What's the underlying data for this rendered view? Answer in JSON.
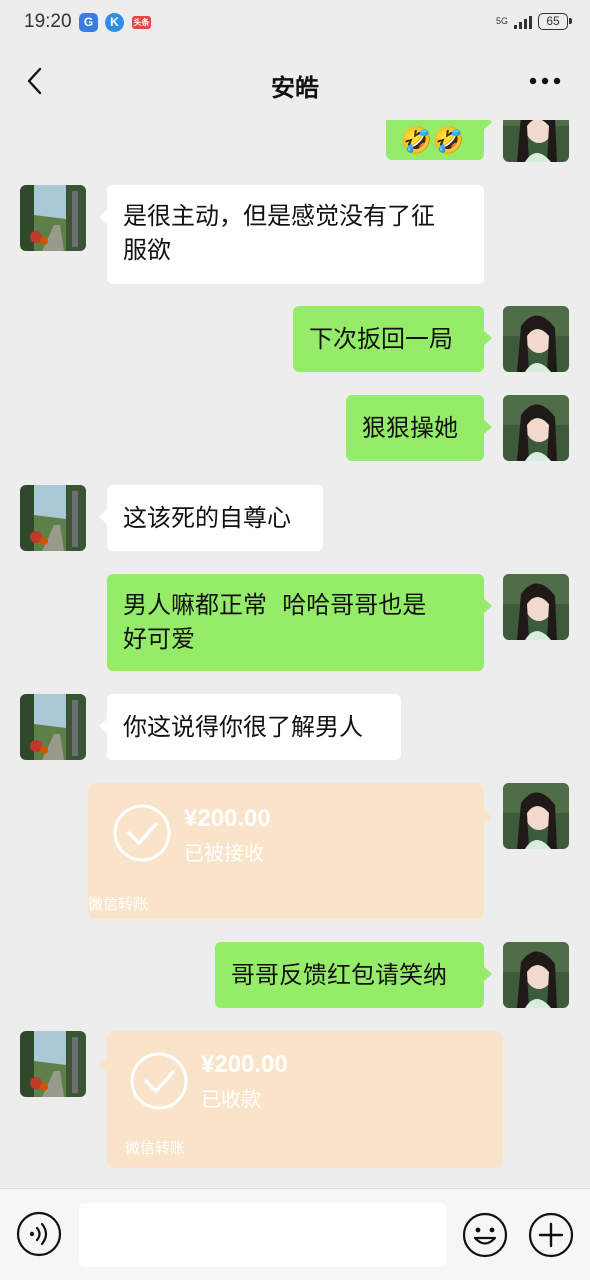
{
  "status_bar": {
    "time": "19:20",
    "app_icon_1": "G",
    "app_icon_2": "K",
    "app_icon_3": "头条",
    "network": "5G",
    "battery": "65"
  },
  "header": {
    "title": "安皓",
    "back_icon": "chevron-left-icon",
    "more_icon": "more-dots-icon"
  },
  "messages": [
    {
      "side": "right",
      "type": "emoji",
      "text": "🤣🤣"
    },
    {
      "side": "left",
      "type": "text",
      "text_line1": "是很主动，但是感觉没有了征",
      "text_line2": "服欲"
    },
    {
      "side": "right",
      "type": "text",
      "text": "下次扳回一局"
    },
    {
      "side": "right",
      "type": "text",
      "text": "狠狠操她"
    },
    {
      "side": "left",
      "type": "text",
      "text": "这该死的自尊心"
    },
    {
      "side": "right",
      "type": "text",
      "text_line1": "男人嘛都正常  哈哈哥哥也是",
      "text_line2": "好可爱"
    },
    {
      "side": "left",
      "type": "text",
      "text": "你这说得你很了解男人"
    },
    {
      "side": "right",
      "type": "transfer",
      "amount": "¥200.00",
      "status": "已被接收",
      "footer": "微信转账"
    },
    {
      "side": "right",
      "type": "text",
      "text": "哥哥反馈红包请笑纳"
    },
    {
      "side": "left",
      "type": "transfer",
      "amount": "¥200.00",
      "status": "已收款",
      "footer": "微信转账"
    }
  ],
  "input_bar": {
    "voice_icon": "voice-icon",
    "emoji_icon": "emoji-icon",
    "plus_icon": "plus-icon"
  },
  "colors": {
    "background": "#ededed",
    "green_bubble": "#95ec69",
    "white_bubble": "#ffffff",
    "transfer_bubble": "#f9e4ca"
  }
}
